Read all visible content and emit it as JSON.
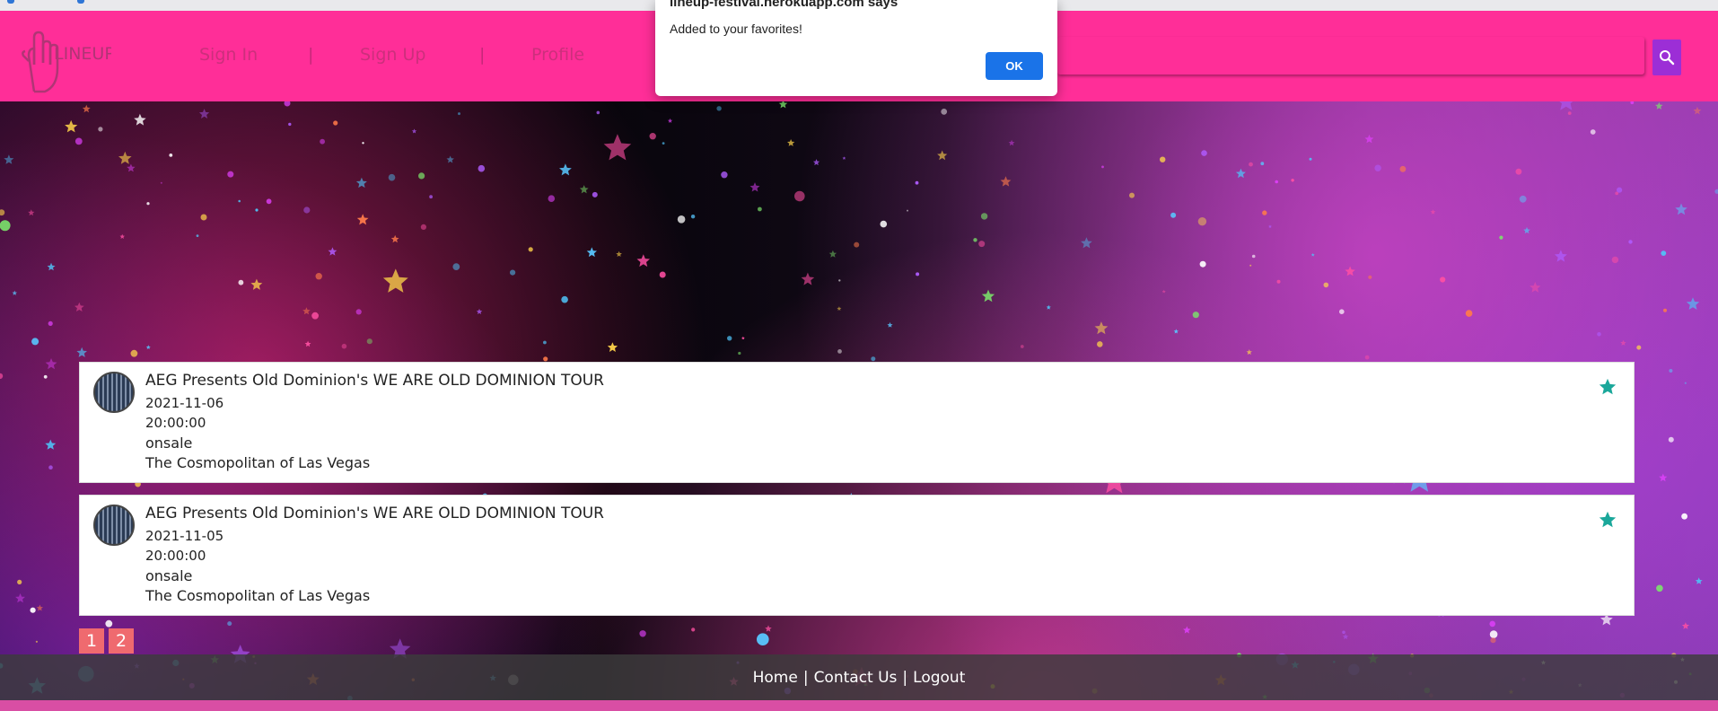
{
  "navbar": {
    "logo_text": "LINEUP",
    "links": {
      "sign_in": "Sign In",
      "sign_up": "Sign Up",
      "profile": "Profile"
    },
    "separator": "|",
    "search_placeholder": ""
  },
  "events": [
    {
      "title": "AEG Presents Old Dominion's WE ARE OLD DOMINION TOUR",
      "date": "2021-11-06",
      "time": "20:00:00",
      "status": "onsale",
      "venue": "The Cosmopolitan of Las Vegas"
    },
    {
      "title": "AEG Presents Old Dominion's WE ARE OLD DOMINION TOUR",
      "date": "2021-11-05",
      "time": "20:00:00",
      "status": "onsale",
      "venue": "The Cosmopolitan of Las Vegas"
    }
  ],
  "pagination": {
    "pages": [
      "1",
      "2"
    ]
  },
  "footer": {
    "home": "Home",
    "contact": "Contact Us",
    "logout": "Logout",
    "separator": "|"
  },
  "dialog": {
    "title": "lineup-festival.herokuapp.com says",
    "message": "Added to your favorites!",
    "ok_label": "OK"
  },
  "colors": {
    "navbar": "#ff2e98",
    "search_button": "#9c2ed6",
    "favorite_star": "#1aa79a",
    "page_button": "#ef6a6f",
    "ok_button": "#1a73e8"
  },
  "icons": {
    "search": "search-icon",
    "favorite": "star-icon",
    "logo": "hand-logo-icon"
  }
}
